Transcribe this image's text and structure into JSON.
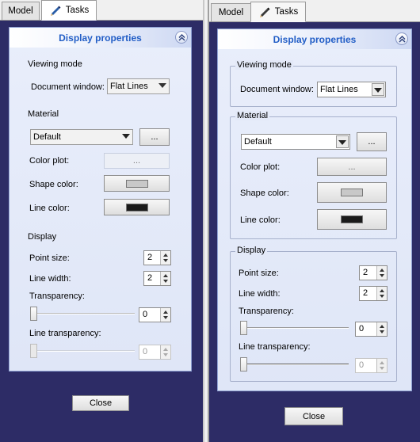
{
  "tabs": [
    {
      "label": "Model",
      "icon": "none"
    },
    {
      "label": "Tasks",
      "icon": "pencil-icon"
    }
  ],
  "panel_title": "Display properties",
  "viewing_mode": {
    "heading": "Viewing mode",
    "doc_window_label": "Document window:",
    "doc_window_value": "Flat Lines"
  },
  "material": {
    "heading": "Material",
    "value": "Default",
    "more_label": "..."
  },
  "color_plot": {
    "label": "Color plot:",
    "button": "..."
  },
  "shape_color": {
    "label": "Shape color:",
    "color": "#c8c8c8"
  },
  "line_color": {
    "label": "Line color:",
    "color": "#1a1a1a"
  },
  "display": {
    "heading": "Display",
    "point_size_label": "Point size:",
    "point_size": "2",
    "line_width_label": "Line width:",
    "line_width": "2",
    "transparency_label": "Transparency:",
    "transparency": "0",
    "line_transparency_label": "Line transparency:",
    "line_transparency": "0"
  },
  "close_label": "Close",
  "colors": {
    "task_background": "#2d2c66",
    "panel_title": "#215dc6"
  }
}
